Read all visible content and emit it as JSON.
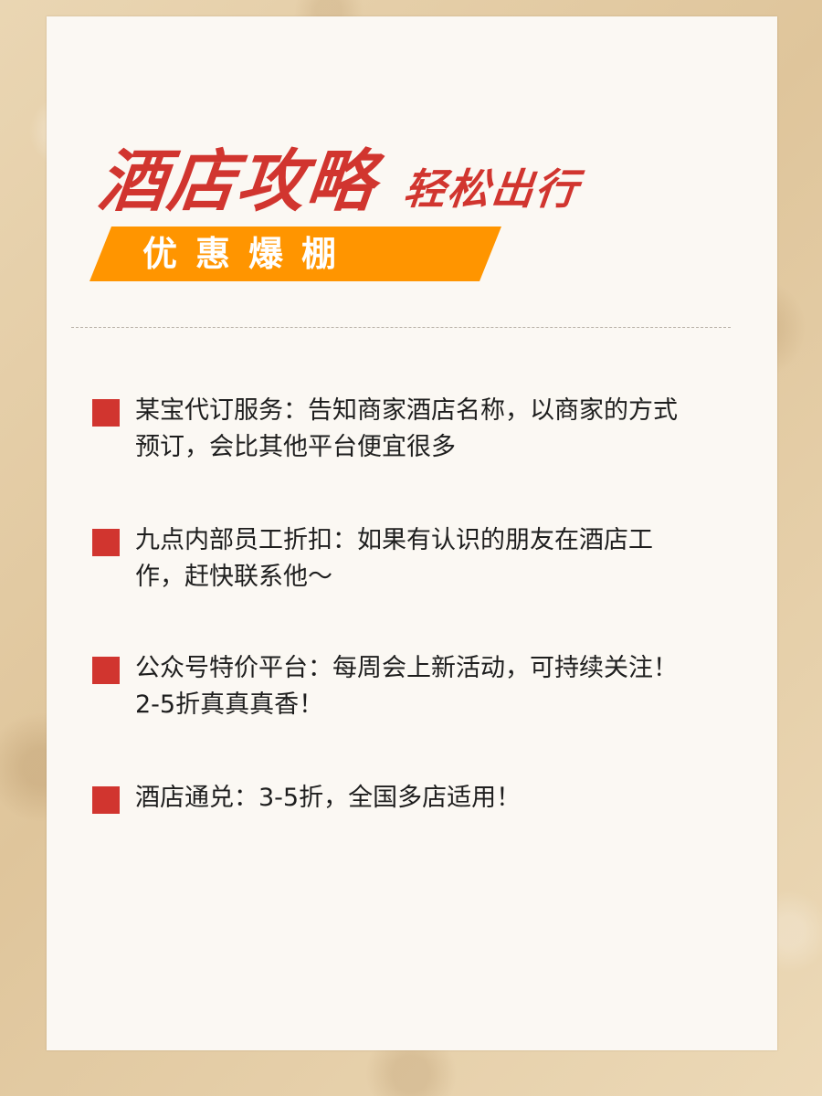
{
  "title": {
    "main": "酒店攻略",
    "sub": "轻松出行"
  },
  "banner": {
    "label": "优惠爆棚"
  },
  "colors": {
    "accent_red": "#d1352f",
    "banner_orange": "#ff9500",
    "card": "#fbf8f3",
    "paper": "#e8d3ad"
  },
  "items": [
    {
      "text": "某宝代订服务：告知商家酒店名称，以商家的方式预订，会比其他平台便宜很多"
    },
    {
      "text": "九点内部员工折扣：如果有认识的朋友在酒店工作，赶快联系他～"
    },
    {
      "text": "公众号特价平台：每周会上新活动，可持续关注！2-5折真真真香！"
    },
    {
      "text": "酒店通兑：3-5折，全国多店适用！"
    }
  ]
}
